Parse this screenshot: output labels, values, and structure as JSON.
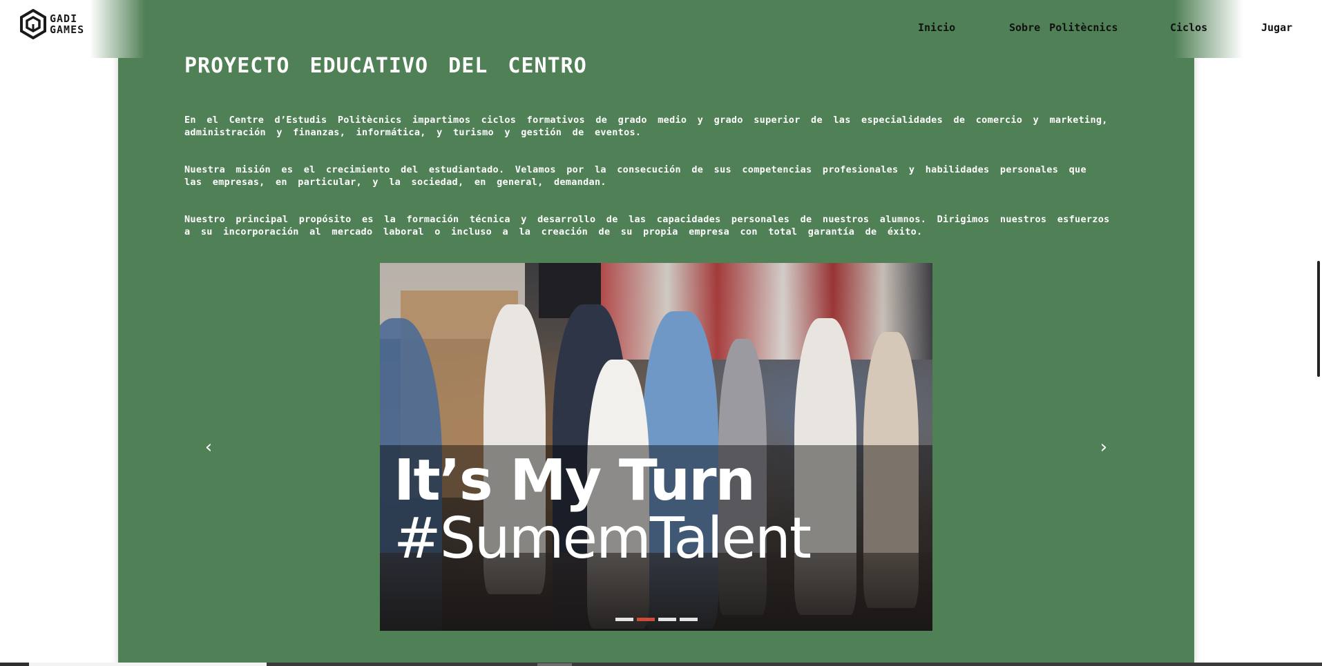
{
  "header": {
    "logo": {
      "line1": "GADI",
      "line2": "GAMES"
    },
    "nav": [
      {
        "label": "Inicio"
      },
      {
        "label": "Sobre Politècnics"
      },
      {
        "label": "Ciclos"
      },
      {
        "label": "Jugar"
      }
    ]
  },
  "section": {
    "title": "PROYECTO EDUCATIVO DEL CENTRO",
    "paragraphs": [
      "En el Centre d’Estudis Politècnics impartimos ciclos formativos de grado medio y grado superior de las especialidades de comercio y marketing, administración y finanzas, informática, y turismo y gestión de eventos.",
      "Nuestra misión es el crecimiento del estudiantado. Velamos por la consecución de sus competencias profesionales y habilidades personales que las empresas, en particular, y la sociedad, en general, demandan.",
      "Nuestro principal propósito es la formación técnica y desarrollo de las capacidades personales de nuestros alumnos. Dirigimos nuestros esfuerzos a su incorporación al mercado laboral o incluso a la creación de su propia empresa con total garantía de éxito."
    ]
  },
  "carousel": {
    "slide_text_line1": "It’s My Turn",
    "slide_text_line2": "#SumemTalent",
    "prev_label": "‹",
    "next_label": "›",
    "slide_count": 4,
    "active_index": 1
  },
  "colors": {
    "panel_green": "#508055",
    "active_indicator": "#cf4a3a"
  }
}
